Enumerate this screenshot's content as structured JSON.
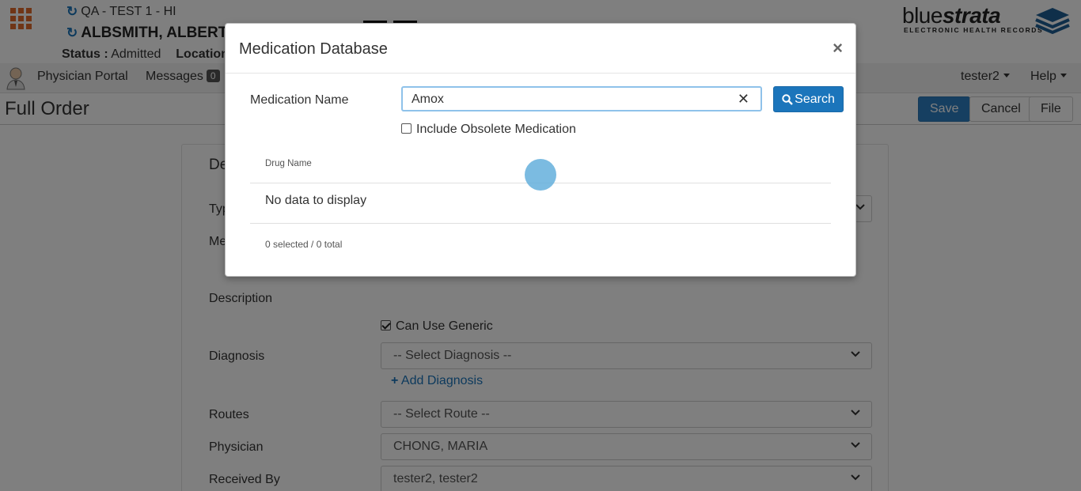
{
  "header": {
    "facility": "QA - TEST 1 - HI",
    "patient_name": "ALBSMITH, ALBERT",
    "status_label": "Status :",
    "status_value": "Admitted",
    "location_label": "Location",
    "logo_blue": "blue",
    "logo_strata": "strata",
    "logo_sub": "ELECTRONIC HEALTH RECORDS"
  },
  "nav": {
    "portal": "Physician Portal",
    "messages": "Messages",
    "messages_count": "0",
    "user": "tester2",
    "help": "Help"
  },
  "titlebar": {
    "title": "Full Order",
    "save": "Save",
    "cancel": "Cancel",
    "file": "File"
  },
  "form": {
    "section_partial": "De",
    "type_partial": "Typ",
    "med_partial": "Me",
    "description_label": "Description",
    "can_use_generic": "Can Use Generic",
    "diagnosis_label": "Diagnosis",
    "diagnosis_value": "-- Select Diagnosis --",
    "add_diagnosis": "Add Diagnosis",
    "routes_label": "Routes",
    "routes_value": "-- Select Route --",
    "physician_label": "Physician",
    "physician_value": "CHONG, MARIA",
    "received_label": "Received By",
    "received_value": "tester2, tester2"
  },
  "modal": {
    "title": "Medication Database",
    "close": "×",
    "med_name_label": "Medication Name",
    "med_name_value": "Amox",
    "clear": "✕",
    "search_button": "Search",
    "obsolete_label": "Include Obsolete Medication",
    "column_drug_name": "Drug Name",
    "empty_text": "No data to display",
    "footer": "0 selected / 0 total"
  },
  "colors": {
    "accent": "#1b75bb",
    "brand_orange": "#e06a2c",
    "overlay": "rgba(0,0,0,0.5)"
  },
  "icons": [
    "apps-grid-icon",
    "refresh-icon",
    "avatar-icon",
    "search-icon",
    "chevron-down-icon",
    "plus-icon",
    "close-icon",
    "clear-icon",
    "bluestrata-stack-icon"
  ]
}
